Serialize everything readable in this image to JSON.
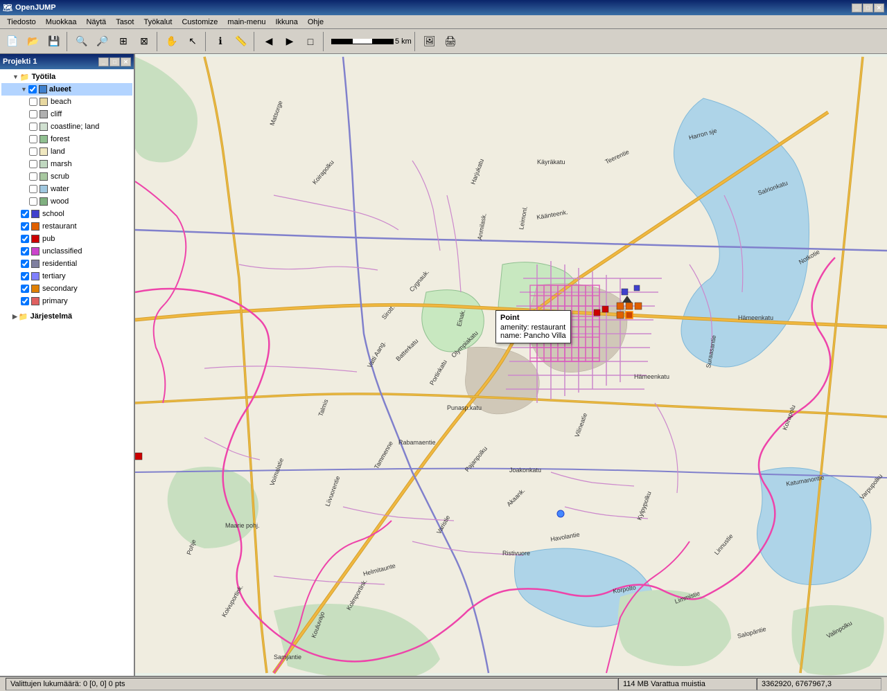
{
  "app": {
    "title": "OpenJUMP",
    "title_icon": "🗺"
  },
  "menu": {
    "items": [
      "Tiedosto",
      "Muokkaa",
      "Näytä",
      "Tasot",
      "Työkalut",
      "Customize",
      "main-menu",
      "Ikkuna",
      "Ohje"
    ]
  },
  "toolbar": {
    "scale_label": "5 km"
  },
  "project": {
    "title": "Projekti 1"
  },
  "tree": {
    "workspace_label": "Työtila",
    "layers_group": "alueet",
    "layers": [
      {
        "name": "beach",
        "color": null,
        "checked": false,
        "indent": 3
      },
      {
        "name": "cliff",
        "color": null,
        "checked": false,
        "indent": 3
      },
      {
        "name": "coastline; land",
        "color": null,
        "checked": false,
        "indent": 3
      },
      {
        "name": "forest",
        "color": "#90c090",
        "checked": false,
        "indent": 3
      },
      {
        "name": "land",
        "color": "#f0e8c0",
        "checked": false,
        "indent": 3
      },
      {
        "name": "marsh",
        "color": null,
        "checked": false,
        "indent": 3
      },
      {
        "name": "scrub",
        "color": null,
        "checked": false,
        "indent": 3
      },
      {
        "name": "water",
        "color": "#a0c8e0",
        "checked": false,
        "indent": 3
      },
      {
        "name": "wood",
        "color": "#80b080",
        "checked": false,
        "indent": 3
      },
      {
        "name": "school",
        "color": "#4040cc",
        "checked": true,
        "indent": 2
      },
      {
        "name": "restaurant",
        "color": "#e06000",
        "checked": true,
        "indent": 2
      },
      {
        "name": "pub",
        "color": "#cc0000",
        "checked": true,
        "indent": 2
      },
      {
        "name": "unclassified",
        "color": "#cc44cc",
        "checked": true,
        "indent": 2
      },
      {
        "name": "residential",
        "color": "#8080a0",
        "checked": true,
        "indent": 2
      },
      {
        "name": "tertiary",
        "color": "#8080ff",
        "checked": true,
        "indent": 2
      },
      {
        "name": "secondary",
        "color": "#e08000",
        "checked": true,
        "indent": 2
      },
      {
        "name": "primary",
        "color": "#e06060",
        "checked": true,
        "indent": 2
      }
    ],
    "system_label": "Järjestelmä"
  },
  "tooltip": {
    "type": "Point",
    "amenity_label": "amenity: restaurant",
    "name_label": "name: Pancho Villa"
  },
  "status": {
    "selection": "Valittujen lukumäärä: 0 [0, 0] 0 pts",
    "memory": "114 MB Varattua muistia",
    "coordinates": "3362920, 6767967,3"
  },
  "colors": {
    "forest": "#c8dfc0",
    "water": "#aed4e8",
    "land": "#f5f0e0",
    "road_primary": "#e08800",
    "road_secondary": "#e09000",
    "road_tertiary": "#8888ff",
    "road_residential": "#cc99cc",
    "road_unclassified": "#cc44cc",
    "building_fill": "#d0c0b0",
    "park_fill": "#b8d8b0"
  }
}
